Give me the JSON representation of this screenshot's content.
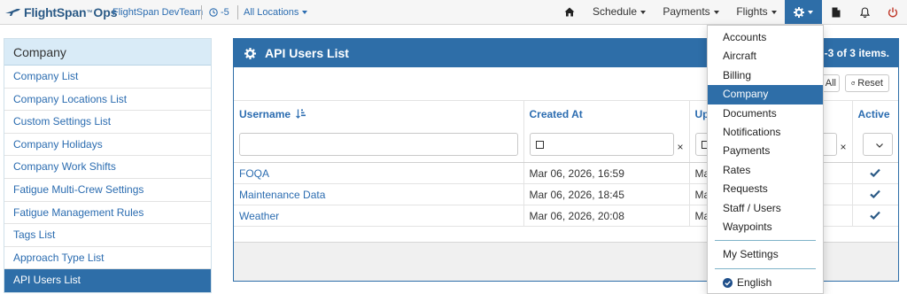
{
  "brand": {
    "name": "FlightSpan",
    "tm": "™",
    "ops": "Ops",
    "team": "FlightSpan DevTeam",
    "timezone": "-5",
    "locations": "All Locations"
  },
  "nav": {
    "schedule": "Schedule",
    "payments": "Payments",
    "flights": "Flights"
  },
  "sidebar": {
    "title": "Company",
    "items": [
      {
        "label": "Company List"
      },
      {
        "label": "Company Locations List"
      },
      {
        "label": "Custom Settings List"
      },
      {
        "label": "Company Holidays"
      },
      {
        "label": "Company Work Shifts"
      },
      {
        "label": "Fatigue Multi-Crew Settings"
      },
      {
        "label": "Fatigue Management Rules"
      },
      {
        "label": "Tags List"
      },
      {
        "label": "Approach Type List"
      },
      {
        "label": "API Users List"
      }
    ]
  },
  "panel": {
    "title": "API Users List",
    "count": "-3 of 3 items.",
    "all_label": "All",
    "reset_label": "Reset",
    "columns": [
      "Username",
      "Created At",
      "Up",
      "Active"
    ],
    "rows": [
      {
        "username": "FOQA",
        "created": "Mar 06, 2026, 16:59",
        "updated": "Ma"
      },
      {
        "username": "Maintenance Data",
        "created": "Mar 06, 2026, 18:45",
        "updated": "Ma"
      },
      {
        "username": "Weather",
        "created": "Mar 06, 2026, 20:08",
        "updated": "Ma"
      }
    ],
    "clear_symbol": "×"
  },
  "dropdown": {
    "items": [
      "Accounts",
      "Aircraft",
      "Billing",
      "Company",
      "Documents",
      "Notifications",
      "Payments",
      "Rates",
      "Requests",
      "Staff / Users",
      "Waypoints"
    ],
    "active": "Company",
    "settings": "My Settings",
    "language": "English"
  },
  "colors": {
    "primary": "#2e6ea8",
    "link": "#2b6cb0",
    "sidebar_head": "#d9ebf7"
  }
}
